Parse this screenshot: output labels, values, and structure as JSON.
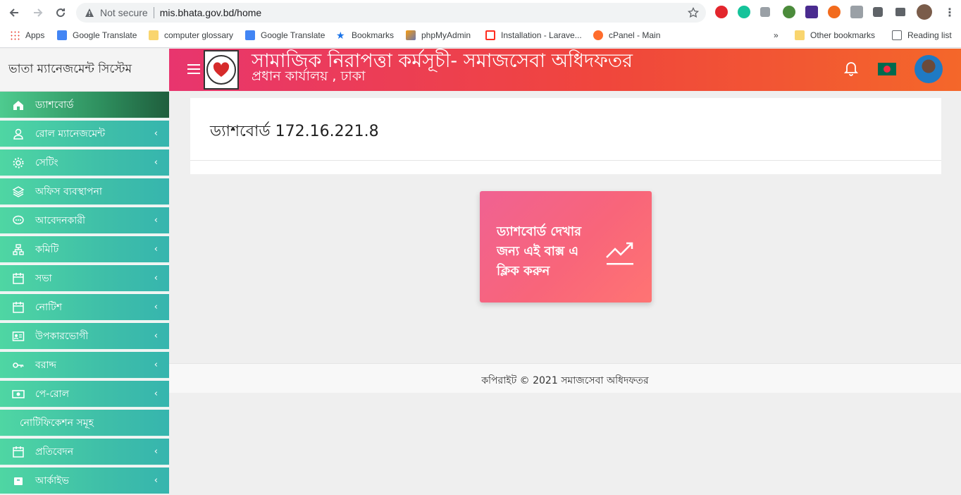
{
  "browser": {
    "security_label": "Not secure",
    "url": "mis.bhata.gov.bd/home",
    "bookmarks": [
      {
        "label": "Apps",
        "icon": "apps-grid-icon"
      },
      {
        "label": "Google Translate",
        "icon": "google-translate-icon"
      },
      {
        "label": "computer glossary",
        "icon": "folder-icon"
      },
      {
        "label": "Google Translate",
        "icon": "google-translate-icon"
      },
      {
        "label": "Bookmarks",
        "icon": "star-icon"
      },
      {
        "label": "phpMyAdmin",
        "icon": "phpmyadmin-icon"
      },
      {
        "label": "Installation - Larave...",
        "icon": "laravel-icon"
      },
      {
        "label": "cPanel - Main",
        "icon": "cpanel-icon"
      }
    ],
    "overflow": "»",
    "other_bookmarks": "Other bookmarks",
    "reading_list": "Reading list"
  },
  "sidebar": {
    "brand": "ভাতা ম্যানেজমেন্ট সিস্টেম",
    "items": [
      {
        "label": "ড্যাশবোর্ড",
        "icon": "home-icon",
        "has_children": false,
        "active": true
      },
      {
        "label": "রোল ম্যানেজমেন্ট",
        "icon": "user-icon",
        "has_children": true
      },
      {
        "label": "সেটিং",
        "icon": "gear-icon",
        "has_children": true
      },
      {
        "label": "অফিস ব্যবস্থাপনা",
        "icon": "layers-icon",
        "has_children": false
      },
      {
        "label": "আবেদনকারী",
        "icon": "chat-icon",
        "has_children": true
      },
      {
        "label": "কমিটি",
        "icon": "sitemap-icon",
        "has_children": true
      },
      {
        "label": "সভা",
        "icon": "calendar-icon",
        "has_children": true
      },
      {
        "label": "নোটিশ",
        "icon": "calendar-icon",
        "has_children": true
      },
      {
        "label": "উপকারভোগী",
        "icon": "id-card-icon",
        "has_children": true
      },
      {
        "label": "বরাদ্দ",
        "icon": "key-icon",
        "has_children": true
      },
      {
        "label": "পে-রোল",
        "icon": "money-icon",
        "has_children": true
      },
      {
        "label": "নোটিফিকেশন সমূহ",
        "icon": "",
        "has_children": false
      },
      {
        "label": "প্রতিবেদন",
        "icon": "calendar-icon",
        "has_children": true
      },
      {
        "label": "আর্কাইভ",
        "icon": "archive-icon",
        "has_children": true
      }
    ]
  },
  "header": {
    "title": "সামাজিক নিরাপত্তা কর্মসূচী- সমাজসেবা অধিদফতর",
    "subtitle": "প্রধান কার্যালয় , ঢাকা"
  },
  "main": {
    "page_title": "ড্যাশবোর্ড 172.16.221.8",
    "tile_text": "ড্যাশবোর্ড দেখার জন্য এই বাক্স এ ক্লিক করুন"
  },
  "footer": {
    "copyright": "কপিরাইট © 2021 সমাজসেবা অধিদফতর"
  },
  "colors": {
    "header_gradient_start": "#e8356e",
    "header_gradient_end": "#f4672a",
    "sidebar_item": "#3fbfa8",
    "tile": "#f8657a"
  }
}
